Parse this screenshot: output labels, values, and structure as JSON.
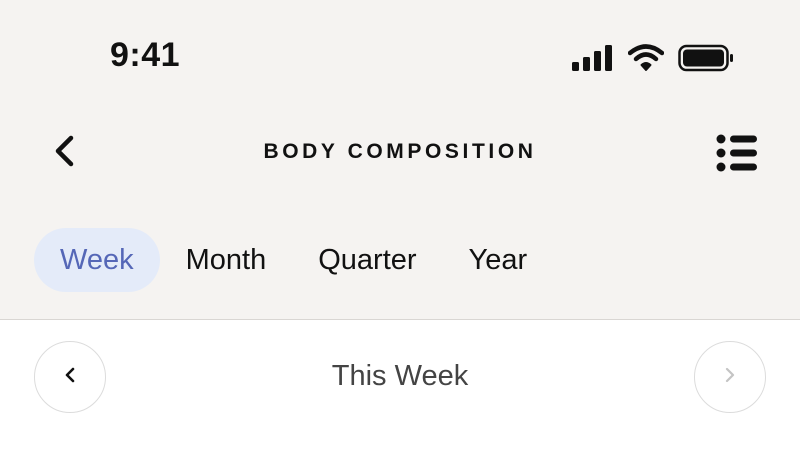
{
  "status_bar": {
    "time": "9:41",
    "icons": [
      "cellular-signal-icon",
      "wifi-icon",
      "battery-icon"
    ]
  },
  "header": {
    "title": "BODY COMPOSITION",
    "back_icon": "chevron-left-icon",
    "menu_icon": "list-icon"
  },
  "tabs": [
    {
      "label": "Week",
      "active": true
    },
    {
      "label": "Month",
      "active": false
    },
    {
      "label": "Quarter",
      "active": false
    },
    {
      "label": "Year",
      "active": false
    }
  ],
  "period_nav": {
    "label": "This Week",
    "prev_icon": "chevron-left-icon",
    "next_icon": "chevron-right-icon",
    "next_enabled": false
  },
  "colors": {
    "background": "#f5f3f1",
    "content_background": "#ffffff",
    "active_tab_bg": "#e4ebf9",
    "active_tab_text": "#5567b7",
    "disabled_icon": "#c4c4c4"
  }
}
